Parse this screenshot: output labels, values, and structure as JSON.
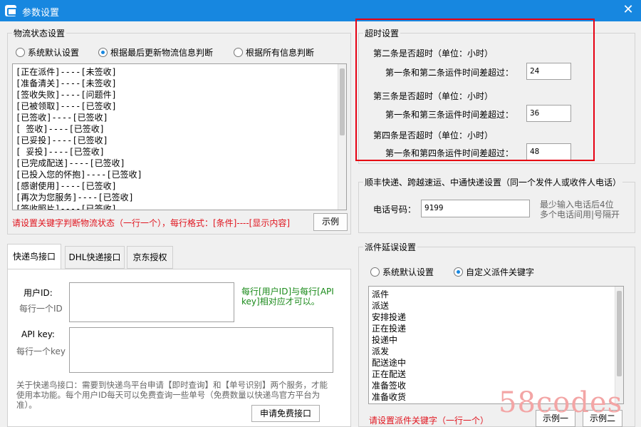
{
  "window": {
    "title": "参数设置",
    "close_glyph": "✕"
  },
  "logistics": {
    "group_title": "物流状态设置",
    "radios": [
      {
        "label": "系统默认设置",
        "checked": false
      },
      {
        "label": "根据最后更新物流信息判断",
        "checked": true
      },
      {
        "label": "根据所有信息判断",
        "checked": false
      }
    ],
    "lines": [
      "[正在派件]----[未签收]",
      "[准备清关]----[未签收]",
      "[签收失败]----[问题件]",
      "[已被领取]----[已签收]",
      "[已签收]----[已签收]",
      "[ 签收]----[已签收]",
      "[已妥投]----[已签收]",
      "[ 妥投]----[已签收]",
      "[已完成配送]----[已签收]",
      "[已投入您的怀抱]----[已签收]",
      "[感谢使用]----[已签收]",
      "[再次为您服务]----[已签收]",
      "[签收照片]----[已签收]"
    ],
    "hint": "请设置关键字判断物流状态（一行一个），每行格式：[条件]----[显示内容]",
    "example_button": "示例"
  },
  "timeout": {
    "group_title": "超时设置",
    "rows": [
      {
        "heading": "第二条是否超时（单位：小时）",
        "label": "第一条和第二条运件时间差超过：",
        "value": "24"
      },
      {
        "heading": "第三条是否超时（单位：小时）",
        "label": "第一条和第三条运件时间差超过：",
        "value": "36"
      },
      {
        "heading": "第四条是否超时（单位：小时）",
        "label": "第一条和第四条运件时间差超过：",
        "value": "48"
      }
    ]
  },
  "phone": {
    "group_title": "顺丰快递、跨越速运、中通快递设置（同一个发件人或收件人电话）",
    "label": "电话号码：",
    "value": "9199",
    "note_line1": "最少输入电话后4位",
    "note_line2": "多个电话间用|号隔开"
  },
  "tabs": {
    "items": [
      "快递鸟接口",
      "DHL快递接口",
      "京东授权"
    ],
    "active": 0,
    "panel": {
      "userid_label": "用户ID:",
      "userid_sub": "每行一个ID",
      "userid_note": "每行[用户ID]与每行[API key]相对应才可以。",
      "apikey_label": "API key:",
      "apikey_sub": "每行一个key",
      "about": "关于快递鸟接口：需要到快递鸟平台申请【即时查询】和【单号识别】两个服务，才能使用本功能。每个用户ID每天可以免费查询一些单号（免费数量以快递鸟官方平台为准）。",
      "apply_button": "申请免费接口"
    }
  },
  "dispatch": {
    "group_title": "派件延误设置",
    "radios": [
      {
        "label": "系统默认设置",
        "checked": false
      },
      {
        "label": "自定义派件关键字",
        "checked": true
      }
    ],
    "keywords": [
      "派件",
      "派送",
      "安排投递",
      "正在投递",
      "投递中",
      "派发",
      "配送途中",
      "正在配送",
      "准备签收",
      "准备收货"
    ],
    "hint": "请设置派件关键字（一行一个）",
    "example1_button": "示例一",
    "example2_button": "示例二"
  },
  "watermark": "58codes"
}
